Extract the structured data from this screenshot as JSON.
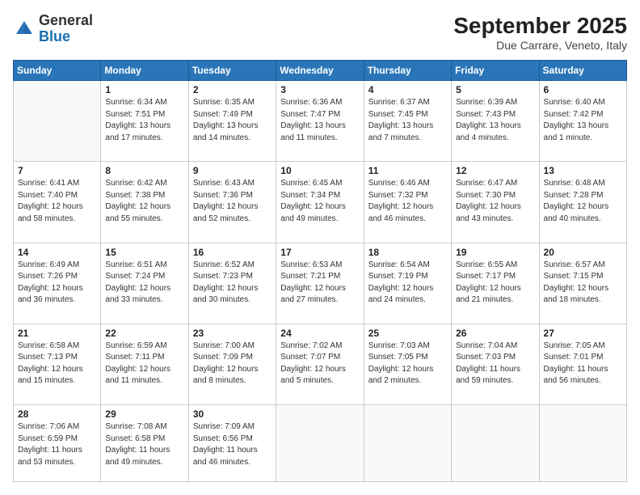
{
  "header": {
    "logo_general": "General",
    "logo_blue": "Blue",
    "month_year": "September 2025",
    "location": "Due Carrare, Veneto, Italy"
  },
  "days_of_week": [
    "Sunday",
    "Monday",
    "Tuesday",
    "Wednesday",
    "Thursday",
    "Friday",
    "Saturday"
  ],
  "weeks": [
    [
      {
        "day": "",
        "info": ""
      },
      {
        "day": "1",
        "info": "Sunrise: 6:34 AM\nSunset: 7:51 PM\nDaylight: 13 hours\nand 17 minutes."
      },
      {
        "day": "2",
        "info": "Sunrise: 6:35 AM\nSunset: 7:49 PM\nDaylight: 13 hours\nand 14 minutes."
      },
      {
        "day": "3",
        "info": "Sunrise: 6:36 AM\nSunset: 7:47 PM\nDaylight: 13 hours\nand 11 minutes."
      },
      {
        "day": "4",
        "info": "Sunrise: 6:37 AM\nSunset: 7:45 PM\nDaylight: 13 hours\nand 7 minutes."
      },
      {
        "day": "5",
        "info": "Sunrise: 6:39 AM\nSunset: 7:43 PM\nDaylight: 13 hours\nand 4 minutes."
      },
      {
        "day": "6",
        "info": "Sunrise: 6:40 AM\nSunset: 7:42 PM\nDaylight: 13 hours\nand 1 minute."
      }
    ],
    [
      {
        "day": "7",
        "info": "Sunrise: 6:41 AM\nSunset: 7:40 PM\nDaylight: 12 hours\nand 58 minutes."
      },
      {
        "day": "8",
        "info": "Sunrise: 6:42 AM\nSunset: 7:38 PM\nDaylight: 12 hours\nand 55 minutes."
      },
      {
        "day": "9",
        "info": "Sunrise: 6:43 AM\nSunset: 7:36 PM\nDaylight: 12 hours\nand 52 minutes."
      },
      {
        "day": "10",
        "info": "Sunrise: 6:45 AM\nSunset: 7:34 PM\nDaylight: 12 hours\nand 49 minutes."
      },
      {
        "day": "11",
        "info": "Sunrise: 6:46 AM\nSunset: 7:32 PM\nDaylight: 12 hours\nand 46 minutes."
      },
      {
        "day": "12",
        "info": "Sunrise: 6:47 AM\nSunset: 7:30 PM\nDaylight: 12 hours\nand 43 minutes."
      },
      {
        "day": "13",
        "info": "Sunrise: 6:48 AM\nSunset: 7:28 PM\nDaylight: 12 hours\nand 40 minutes."
      }
    ],
    [
      {
        "day": "14",
        "info": "Sunrise: 6:49 AM\nSunset: 7:26 PM\nDaylight: 12 hours\nand 36 minutes."
      },
      {
        "day": "15",
        "info": "Sunrise: 6:51 AM\nSunset: 7:24 PM\nDaylight: 12 hours\nand 33 minutes."
      },
      {
        "day": "16",
        "info": "Sunrise: 6:52 AM\nSunset: 7:23 PM\nDaylight: 12 hours\nand 30 minutes."
      },
      {
        "day": "17",
        "info": "Sunrise: 6:53 AM\nSunset: 7:21 PM\nDaylight: 12 hours\nand 27 minutes."
      },
      {
        "day": "18",
        "info": "Sunrise: 6:54 AM\nSunset: 7:19 PM\nDaylight: 12 hours\nand 24 minutes."
      },
      {
        "day": "19",
        "info": "Sunrise: 6:55 AM\nSunset: 7:17 PM\nDaylight: 12 hours\nand 21 minutes."
      },
      {
        "day": "20",
        "info": "Sunrise: 6:57 AM\nSunset: 7:15 PM\nDaylight: 12 hours\nand 18 minutes."
      }
    ],
    [
      {
        "day": "21",
        "info": "Sunrise: 6:58 AM\nSunset: 7:13 PM\nDaylight: 12 hours\nand 15 minutes."
      },
      {
        "day": "22",
        "info": "Sunrise: 6:59 AM\nSunset: 7:11 PM\nDaylight: 12 hours\nand 11 minutes."
      },
      {
        "day": "23",
        "info": "Sunrise: 7:00 AM\nSunset: 7:09 PM\nDaylight: 12 hours\nand 8 minutes."
      },
      {
        "day": "24",
        "info": "Sunrise: 7:02 AM\nSunset: 7:07 PM\nDaylight: 12 hours\nand 5 minutes."
      },
      {
        "day": "25",
        "info": "Sunrise: 7:03 AM\nSunset: 7:05 PM\nDaylight: 12 hours\nand 2 minutes."
      },
      {
        "day": "26",
        "info": "Sunrise: 7:04 AM\nSunset: 7:03 PM\nDaylight: 11 hours\nand 59 minutes."
      },
      {
        "day": "27",
        "info": "Sunrise: 7:05 AM\nSunset: 7:01 PM\nDaylight: 11 hours\nand 56 minutes."
      }
    ],
    [
      {
        "day": "28",
        "info": "Sunrise: 7:06 AM\nSunset: 6:59 PM\nDaylight: 11 hours\nand 53 minutes."
      },
      {
        "day": "29",
        "info": "Sunrise: 7:08 AM\nSunset: 6:58 PM\nDaylight: 11 hours\nand 49 minutes."
      },
      {
        "day": "30",
        "info": "Sunrise: 7:09 AM\nSunset: 6:56 PM\nDaylight: 11 hours\nand 46 minutes."
      },
      {
        "day": "",
        "info": ""
      },
      {
        "day": "",
        "info": ""
      },
      {
        "day": "",
        "info": ""
      },
      {
        "day": "",
        "info": ""
      }
    ]
  ]
}
